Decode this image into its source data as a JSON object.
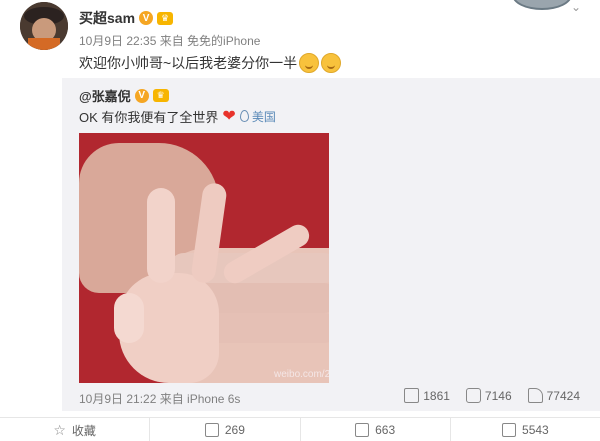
{
  "post": {
    "author": "买超sam",
    "verified_badge": "V",
    "level_badge": "♛",
    "meta": "10月9日 22:35 来自 免免的iPhone",
    "text": "欢迎你小帅哥~以后我老婆分你一半"
  },
  "repost": {
    "author": "@张嘉倪",
    "verified_badge": "V",
    "level_badge": "♛",
    "text": "OK 有你我便有了全世界",
    "heart": "❤",
    "location": "美国",
    "image_watermark": "weibo.com/2",
    "meta": "10月9日 21:22 来自 iPhone 6s",
    "actions": {
      "repost_count": "1861",
      "comment_count": "7146",
      "like_count": "77424"
    }
  },
  "bottom_bar": {
    "favorite_label": "收藏",
    "repost_count": "269",
    "comment_count": "663",
    "like_count": "5543"
  },
  "colors": {
    "verified": "#f5a623",
    "location": "#5b8ab8",
    "photo_bg": "#b1272f"
  }
}
